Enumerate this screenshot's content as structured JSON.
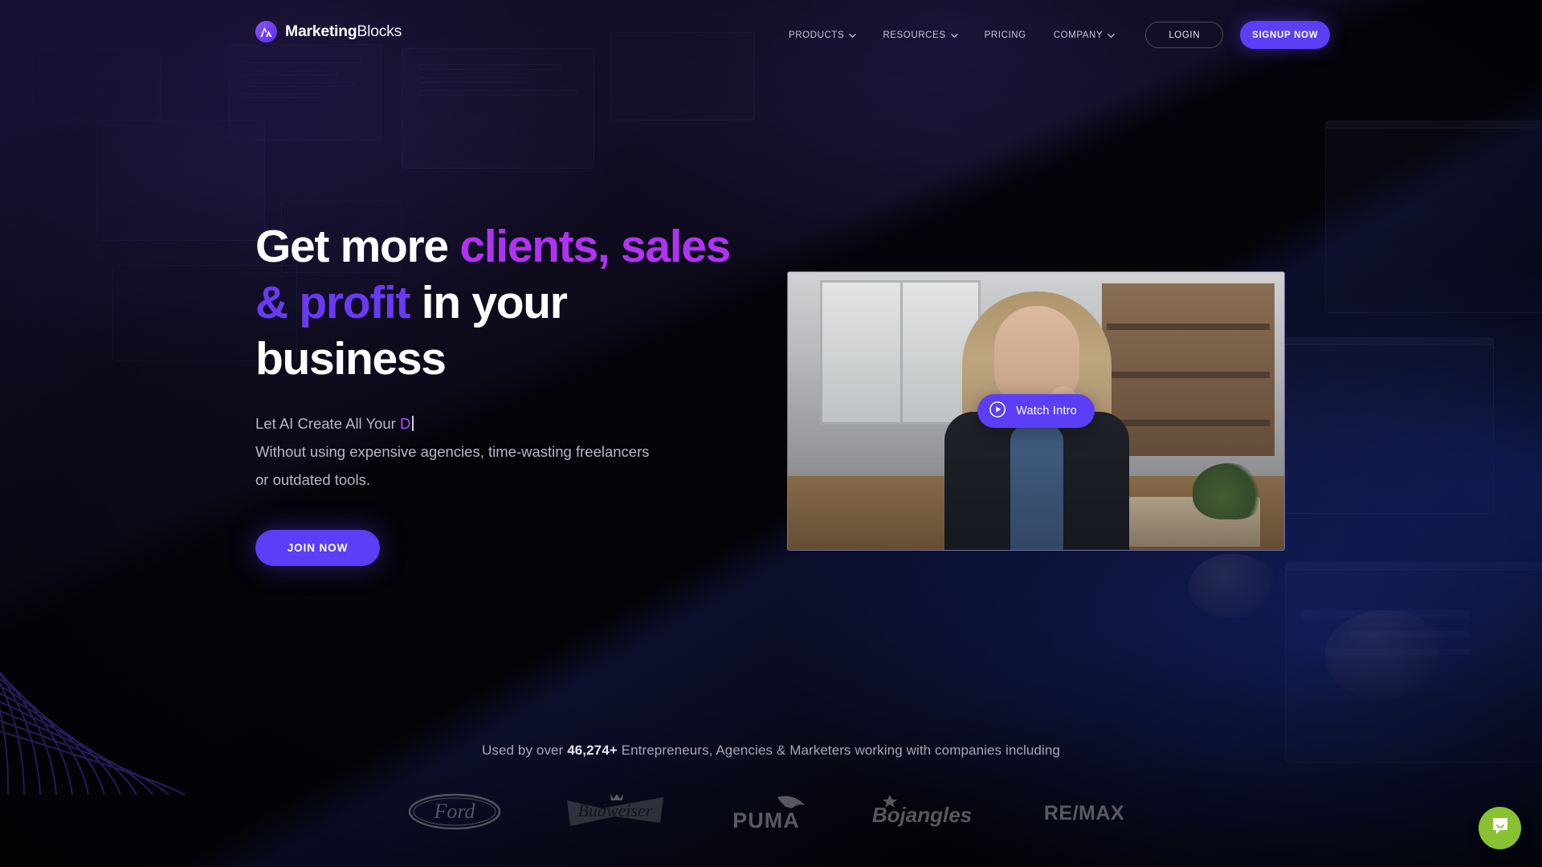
{
  "brand": {
    "name_bold": "Marketing",
    "name_light": "Blocks",
    "logo_icon": "marketingblocks-logo-icon",
    "accent_violet": "#5b3ef5",
    "accent_magenta": "#b033f2",
    "accent_purple": "#6a3af2"
  },
  "nav": {
    "items": [
      {
        "label": "PRODUCTS",
        "has_caret": true,
        "icon": "chevron-down-icon"
      },
      {
        "label": "RESOURCES",
        "has_caret": true,
        "icon": "chevron-down-icon"
      },
      {
        "label": "PRICING",
        "has_caret": false,
        "icon": ""
      },
      {
        "label": "COMPANY",
        "has_caret": true,
        "icon": "chevron-down-icon"
      }
    ],
    "login_label": "LOGIN",
    "signup_label": "SIGNUP NOW"
  },
  "hero": {
    "headline": {
      "part1": "Get more ",
      "highlight1": "clients, sales",
      "part2": " ",
      "highlight2": "& profit",
      "part3": " in your",
      "part4": "business"
    },
    "typed_prefix": "Let AI Create All Your ",
    "typed_value": "D",
    "sub_line2": "Without using expensive agencies, time-wasting freelancers",
    "sub_line3": "or outdated tools.",
    "cta_label": "JOIN NOW"
  },
  "video": {
    "watch_label": "Watch Intro",
    "play_icon": "play-circle-icon"
  },
  "proof": {
    "prefix": "Used by over ",
    "count": "46,274+",
    "suffix": " Entrepreneurs, Agencies & Marketers working with companies including",
    "brands": [
      {
        "name": "Ford",
        "icon": "ford-logo-icon"
      },
      {
        "name": "Budweiser",
        "icon": "budweiser-logo-icon"
      },
      {
        "name": "PUMA",
        "icon": "puma-logo-icon"
      },
      {
        "name": "Bojangles",
        "icon": "bojangles-logo-icon"
      },
      {
        "name": "RE/MAX",
        "icon": "remax-logo-icon"
      }
    ]
  },
  "chat": {
    "icon": "chat-bubble-icon",
    "color": "#86c232"
  }
}
